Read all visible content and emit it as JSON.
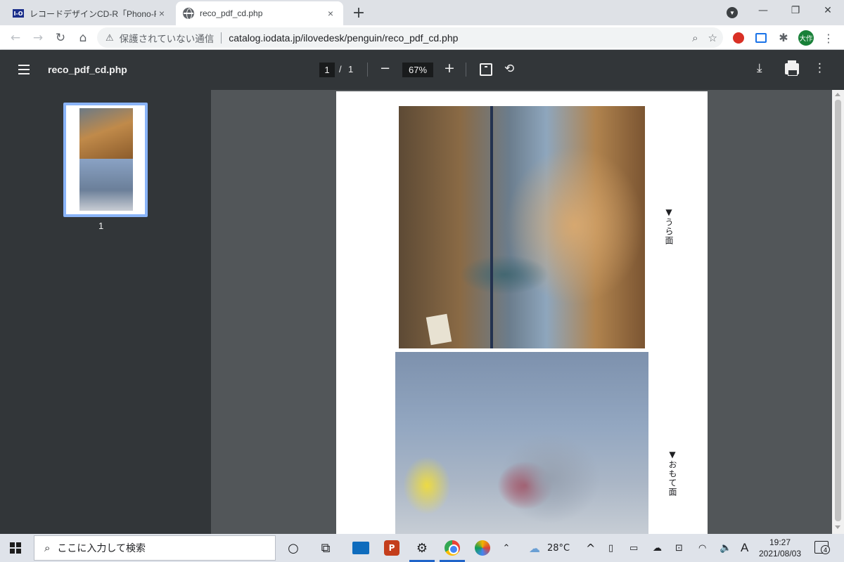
{
  "browser": {
    "tabs": [
      {
        "title": "レコードデザインCD-R「Phono-R」×ジ",
        "active": false,
        "favicon": "iodata-logo"
      },
      {
        "title": "reco_pdf_cd.php",
        "active": true,
        "favicon": "globe-icon"
      }
    ],
    "favicon_iodata_text": "I-O",
    "tab_close_glyph": "×",
    "new_tab_glyph": "+",
    "window_controls": {
      "minimize": "—",
      "restore": "❐",
      "close": "✕"
    },
    "nav": {
      "back": "←",
      "forward": "→",
      "reload": "↻",
      "home": "⌂"
    },
    "omnibox": {
      "security_icon": "⚠",
      "security_label": "保護されていない通信",
      "url": "catalog.iodata.jp/ilovedesk/penguin/reco_pdf_cd.php",
      "zoom_icon": "⌕",
      "bookmark_icon": "☆"
    },
    "extensions": {
      "puzzle_icon": "✱"
    },
    "profile_initials": "大作",
    "menu_glyph": "⋮"
  },
  "pdf_viewer": {
    "menu_icon": "menu-icon",
    "title": "reco_pdf_cd.php",
    "current_page": "1",
    "page_separator": "/",
    "total_pages": "1",
    "zoom_out": "−",
    "zoom_level": "67%",
    "zoom_in": "+",
    "rotate_glyph": "⟲",
    "download_glyph": "⤓",
    "more_glyph": "⋮",
    "thumbnail_label": "1"
  },
  "document": {
    "labels": {
      "back": "▼うら面",
      "front": "▼おもて面"
    },
    "photos": [
      {
        "subject": "child with dinosaur skeleton in museum"
      },
      {
        "subject": "child inside shark mouth sculpture"
      }
    ]
  },
  "taskbar": {
    "search_placeholder": "ここに入力して検索",
    "search_icon": "⌕",
    "cortana_glyph": "○",
    "taskview_glyph": "⧉",
    "ppt_letter": "P",
    "settings_glyph": "⚙",
    "tray_chevron": "⌃",
    "weather_icon": "☁",
    "temperature": "28°C",
    "show_hidden_glyph": "^",
    "ime_label": "A",
    "volume_glyph": "🔈",
    "time": "19:27",
    "date": "2021/08/03",
    "notifications": "4"
  },
  "colors": {
    "pdf_toolbar": "#323639",
    "viewer_bg": "#525659",
    "thumb_highlight": "#8ab4f8",
    "taskbar_bg": "#dfe3ea"
  }
}
